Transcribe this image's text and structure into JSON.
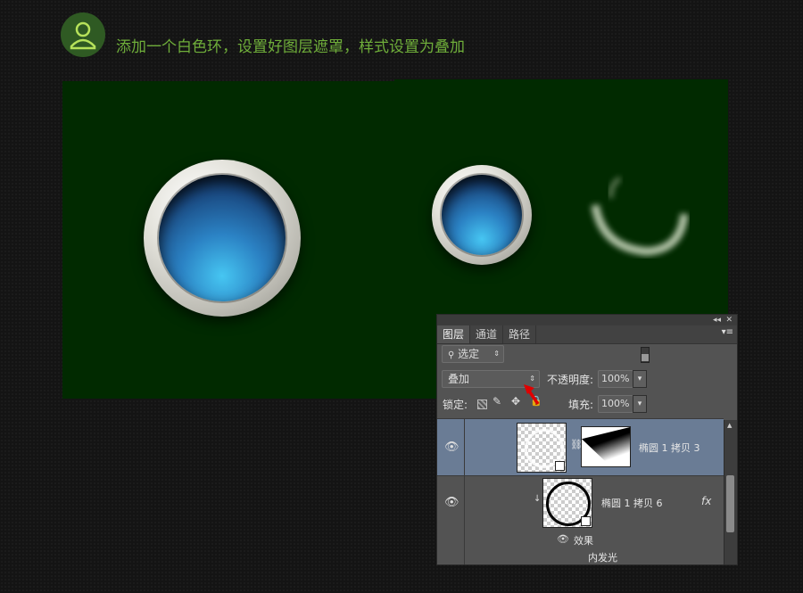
{
  "header": {
    "title": "添加一个白色环，设置好图层遮罩，样式设置为叠加",
    "icon": "user-icon"
  },
  "layers_panel": {
    "tabs": [
      "图层",
      "通道",
      "路径"
    ],
    "active_tab": "图层",
    "filter_label": "选定",
    "blend_mode": "叠加",
    "opacity_label": "不透明度:",
    "opacity_value": "100%",
    "lock_label": "锁定:",
    "fill_label": "填充:",
    "fill_value": "100%",
    "layers": [
      {
        "name": "椭圆 1 拷贝 3",
        "selected": true,
        "has_mask": true
      },
      {
        "name": "椭圆 1 拷贝 6",
        "selected": false,
        "has_fx": true,
        "fx_label": "fx",
        "effects_label": "效果",
        "effects": [
          "内发光"
        ]
      }
    ]
  },
  "colors": {
    "canvas_bg": "#012a00",
    "title_color": "#6fae3a",
    "selected_layer": "#6a7c95",
    "arrow": "#e00000"
  }
}
